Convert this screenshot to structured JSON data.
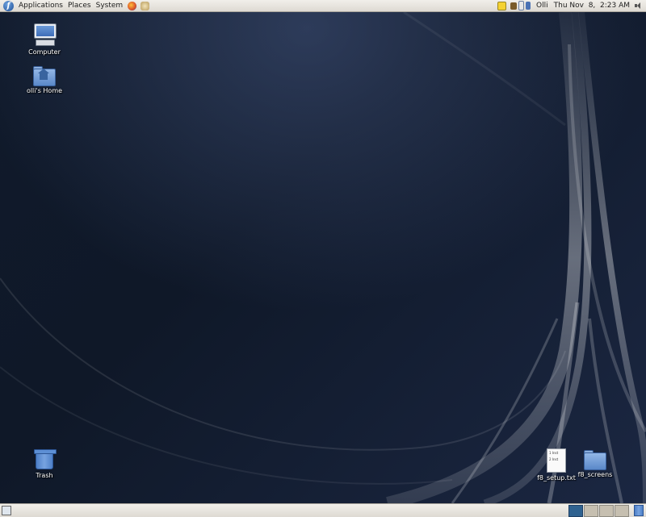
{
  "top_panel": {
    "menus": [
      "Applications",
      "Places",
      "System"
    ],
    "launchers": [
      "firefox-icon",
      "mail-icon"
    ],
    "tray_icons": [
      "notes-icon",
      "book-icon",
      "network-icon"
    ],
    "user": "Olli",
    "clock": "Thu Nov  8,  2:23 AM"
  },
  "desktop": {
    "icons": [
      {
        "name": "computer",
        "label": "Computer"
      },
      {
        "name": "home",
        "label": "olli's Home"
      },
      {
        "name": "trash",
        "label": "Trash"
      },
      {
        "name": "f8-setup",
        "label": "f8_setup.txt",
        "preview_lines": [
          "1 Inst",
          "2 Inst"
        ]
      },
      {
        "name": "f8-screens",
        "label": "f8_screens"
      }
    ]
  },
  "bottom_panel": {
    "workspaces": [
      "1",
      "2",
      "3",
      "4"
    ],
    "active_workspace": "1"
  },
  "colors": {
    "panel": "#e6e3dc",
    "desktop_bg": "#0f1726",
    "active_workspace": "#2f6290"
  }
}
